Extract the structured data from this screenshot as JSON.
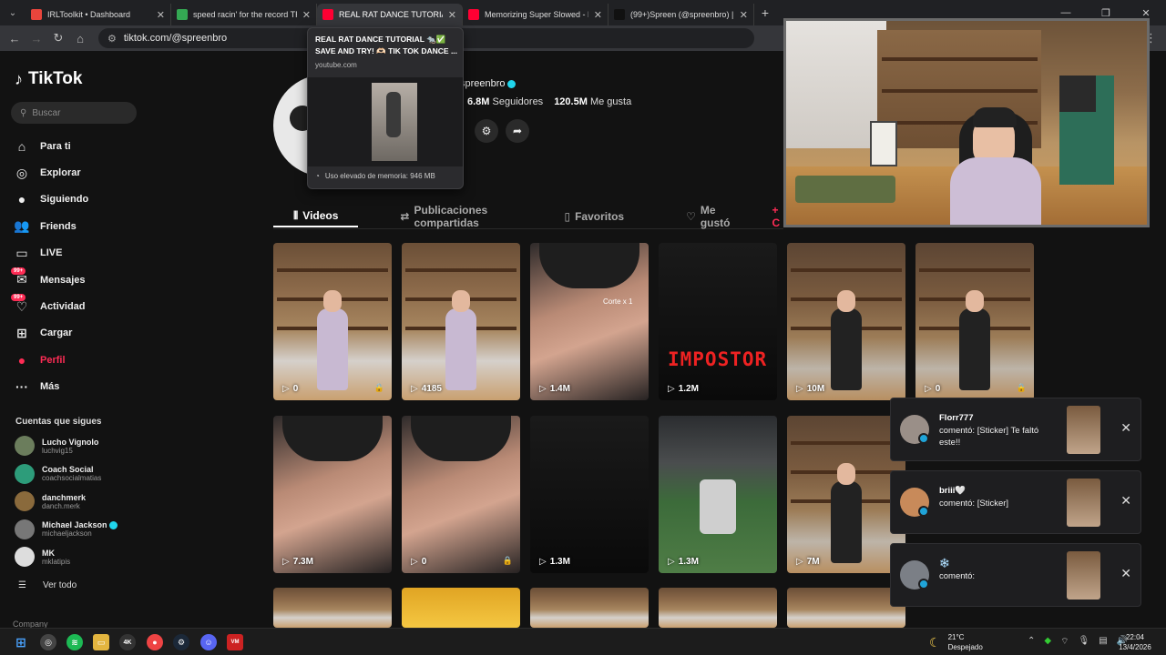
{
  "browser": {
    "tabs": [
      {
        "title": "IRLToolkit • Dashboard",
        "color": "#e8453c"
      },
      {
        "title": "speed racin' for the record TRA",
        "color": "#34a853"
      },
      {
        "title": "REAL RAT DANCE TUTORIAL 🐀",
        "color": "#ff0033"
      },
      {
        "title": "Memorizing Super Slowed - DJ",
        "color": "#ff0033"
      },
      {
        "title": "(99+)Spreen (@spreenbro) | Tik",
        "color": "#111111"
      }
    ],
    "url": "tiktok.com/@spreenbro"
  },
  "hovercard": {
    "title": "REAL RAT DANCE TUTORIAL 🐀✅ SAVE AND TRY! 🫶🏻 TIK TOK DANCE ...",
    "domain": "youtube.com",
    "memory": "Uso elevado de memoria: 946 MB"
  },
  "sidebar": {
    "logo": "TikTok",
    "search_placeholder": "Buscar",
    "nav": [
      {
        "label": "Para ti",
        "icon": "home-icon",
        "glyph": "⌂"
      },
      {
        "label": "Explorar",
        "icon": "compass-icon",
        "glyph": "◎"
      },
      {
        "label": "Siguiendo",
        "icon": "following-icon",
        "glyph": "●"
      },
      {
        "label": "Friends",
        "icon": "friends-icon",
        "glyph": "👥"
      },
      {
        "label": "LIVE",
        "icon": "live-icon",
        "glyph": "▭"
      },
      {
        "label": "Mensajes",
        "icon": "messages-icon",
        "glyph": "✉",
        "badge": "99+"
      },
      {
        "label": "Actividad",
        "icon": "activity-icon",
        "glyph": "♡",
        "badge": "99+"
      },
      {
        "label": "Cargar",
        "icon": "upload-icon",
        "glyph": "⊞"
      },
      {
        "label": "Perfil",
        "icon": "profile-icon",
        "glyph": "●",
        "active": true
      },
      {
        "label": "Más",
        "icon": "more-icon",
        "glyph": "···"
      }
    ],
    "follows_title": "Cuentas que sigues",
    "follows": [
      {
        "name": "Lucho Vignolo",
        "handle": "luchvig15",
        "color": "#6b7d5c"
      },
      {
        "name": "Coach Social",
        "handle": "coachsocialmatias",
        "color": "#2d9c7a"
      },
      {
        "name": "danchmerk",
        "handle": "danch.merk",
        "color": "#8a6a3c"
      },
      {
        "name": "Michael Jackson",
        "handle": "michaeljackson",
        "color": "#777777",
        "verified": true
      },
      {
        "name": "MK",
        "handle": "mklatipis",
        "color": "#dddddd"
      }
    ],
    "see_all": "Ver todo",
    "company": "Company"
  },
  "profile": {
    "username": "spreenbro",
    "followers_count": "6.8M",
    "followers_label": "Seguidores",
    "likes_count": "120.5M",
    "likes_label": "Me gusta",
    "tabs": [
      {
        "label": "Videos",
        "icon": "grid-icon",
        "glyph": "⦀"
      },
      {
        "label": "Publicaciones compartidas",
        "icon": "repost-icon",
        "glyph": "⇄"
      },
      {
        "label": "Favoritos",
        "icon": "bookmark-icon",
        "glyph": "▯"
      },
      {
        "label": "Me gustó",
        "icon": "liked-icon",
        "glyph": "♡"
      },
      {
        "label": "+ C",
        "icon": "plus-icon",
        "glyph": ""
      }
    ]
  },
  "videos_row1": [
    {
      "views": "0",
      "scene": "room",
      "locked": true
    },
    {
      "views": "4185",
      "scene": "room",
      "locked": false
    },
    {
      "views": "1.4M",
      "scene": "closeface",
      "locked": false,
      "overlay": "Corte x 1"
    },
    {
      "views": "1.2M",
      "scene": "dark",
      "locked": false,
      "overlay": "IMPOSTOR"
    },
    {
      "views": "10M",
      "scene": "room2",
      "locked": false
    },
    {
      "views": "0",
      "scene": "room2",
      "locked": true
    }
  ],
  "videos_row2": [
    {
      "views": "7.3M",
      "scene": "closeface",
      "locked": false
    },
    {
      "views": "0",
      "scene": "closeface",
      "locked": true
    },
    {
      "views": "1.3M",
      "scene": "dark",
      "locked": false
    },
    {
      "views": "1.3M",
      "scene": "green",
      "locked": false
    },
    {
      "views": "7M",
      "scene": "room2",
      "locked": false
    }
  ],
  "notifications": [
    {
      "user": "Florr777",
      "message": "comentó: [Sticker] Te faltó este!!"
    },
    {
      "user": "briii🤍",
      "message": "comentó: [Sticker]"
    },
    {
      "user": "❄️",
      "message": "comentó:"
    }
  ],
  "taskbar": {
    "temperature": "21°C",
    "weather": "Despejado",
    "time": "22:04",
    "date": "13/4/2026"
  }
}
